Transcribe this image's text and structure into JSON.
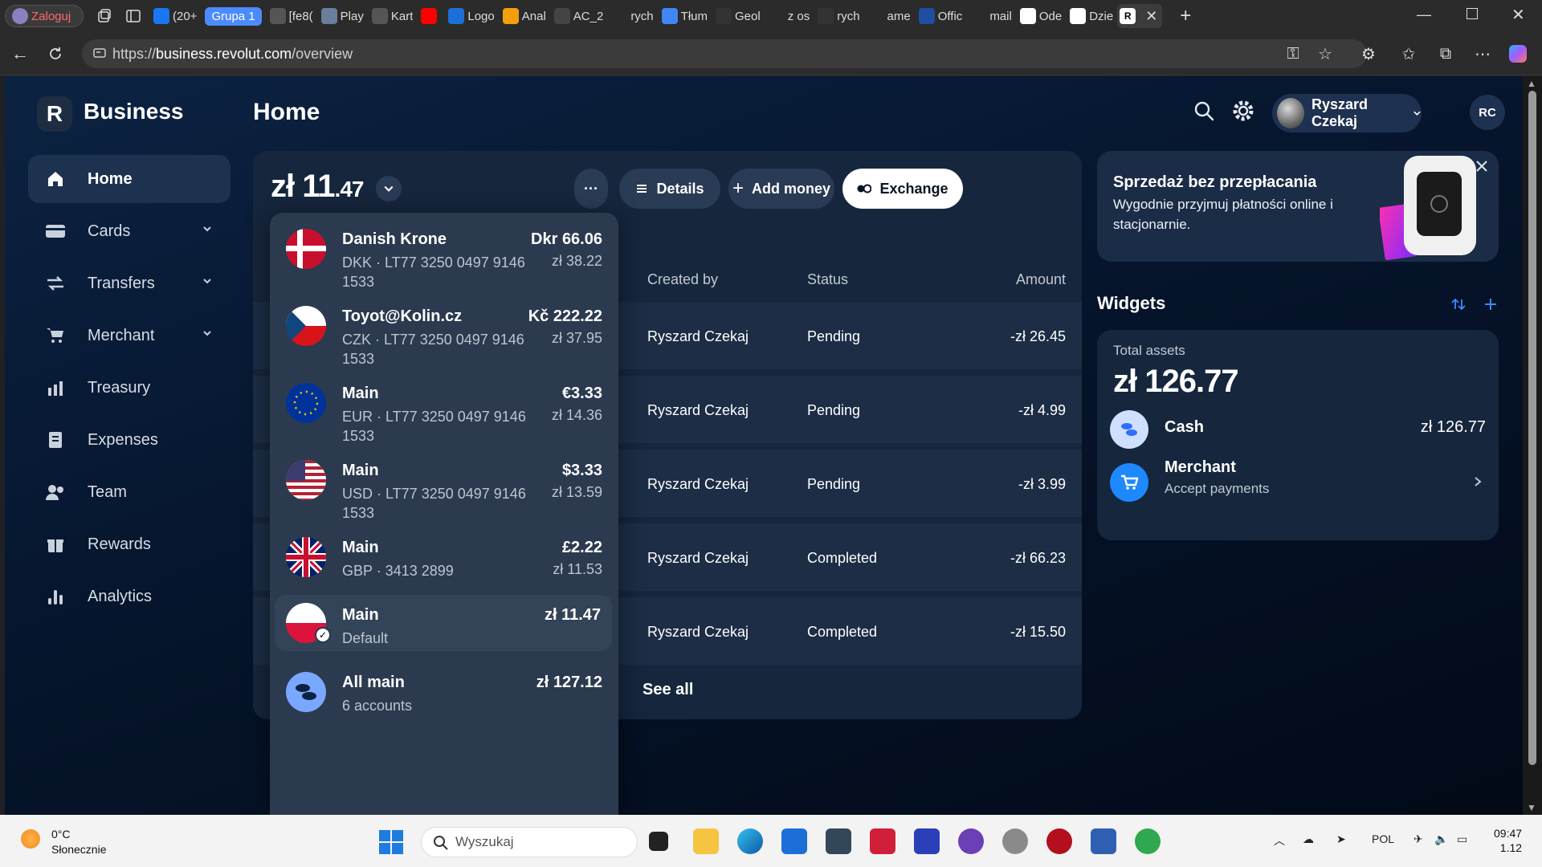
{
  "browser": {
    "profile_tab": "Zaloguj",
    "tabs": [
      {
        "label": "(20+",
        "icon": "facebook-icon"
      },
      {
        "label": "Grupa 1",
        "icon": "tab-group-pill"
      },
      {
        "label": "[fe8(",
        "icon": "globe-icon"
      },
      {
        "label": "Play",
        "icon": "image-icon"
      },
      {
        "label": "Kart",
        "icon": "globe-icon"
      },
      {
        "label": "",
        "icon": "youtube-icon"
      },
      {
        "label": "Logo",
        "icon": "edge-icon"
      },
      {
        "label": "Anal",
        "icon": "analytics-icon"
      },
      {
        "label": "AC_2",
        "icon": "flash-icon"
      },
      {
        "label": "rych",
        "icon": "search-icon"
      },
      {
        "label": "Tłum",
        "icon": "translate-icon"
      },
      {
        "label": "Geol",
        "icon": "github-icon"
      },
      {
        "label": "z os",
        "icon": "search-icon"
      },
      {
        "label": "rych",
        "icon": "github-icon"
      },
      {
        "label": "ame",
        "icon": "search-icon"
      },
      {
        "label": "Offic",
        "icon": "office-icon"
      },
      {
        "label": "mail",
        "icon": "search-icon"
      },
      {
        "label": "Ode",
        "icon": "gmail-icon"
      },
      {
        "label": "Dzie",
        "icon": "gmail-icon"
      }
    ],
    "active_tab_icon": "revolut-icon",
    "url_prefix": "https://",
    "url_host": "business.revolut.com",
    "url_path": "/overview"
  },
  "app": {
    "brand": "Business",
    "logo_letter": "R",
    "page_title": "Home",
    "sidebar": [
      {
        "label": "Home",
        "icon": "home-icon",
        "active": true,
        "expandable": false
      },
      {
        "label": "Cards",
        "icon": "card-icon",
        "active": false,
        "expandable": true
      },
      {
        "label": "Transfers",
        "icon": "transfer-icon",
        "active": false,
        "expandable": true
      },
      {
        "label": "Merchant",
        "icon": "cart-icon",
        "active": false,
        "expandable": true
      },
      {
        "label": "Treasury",
        "icon": "chart-icon",
        "active": false,
        "expandable": false
      },
      {
        "label": "Expenses",
        "icon": "receipt-icon",
        "active": false,
        "expandable": false
      },
      {
        "label": "Team",
        "icon": "team-icon",
        "active": false,
        "expandable": false
      },
      {
        "label": "Rewards",
        "icon": "gift-icon",
        "active": false,
        "expandable": false
      },
      {
        "label": "Analytics",
        "icon": "analytics-icon",
        "active": false,
        "expandable": false
      }
    ],
    "header": {
      "user_name": "Ryszard Czekaj",
      "initials": "RC"
    },
    "balance": {
      "currency": "zł",
      "integer": "11",
      "decimal": ".47"
    },
    "actions": {
      "more": "···",
      "details": "Details",
      "add_money": "Add money",
      "exchange": "Exchange"
    },
    "table": {
      "headers": {
        "created_by": "Created by",
        "status": "Status",
        "amount": "Amount"
      },
      "rows": [
        {
          "created_by": "Ryszard Czekaj",
          "status": "Pending",
          "amount": "-zł 26.45"
        },
        {
          "created_by": "Ryszard Czekaj",
          "status": "Pending",
          "amount": "-zł 4.99"
        },
        {
          "created_by": "Ryszard Czekaj",
          "status": "Pending",
          "amount": "-zł 3.99"
        },
        {
          "created_by": "Ryszard Czekaj",
          "status": "Completed",
          "amount": "-zł 66.23"
        },
        {
          "created_by": "Ryszard Czekaj",
          "status": "Completed",
          "amount": "-zł 15.50"
        }
      ],
      "see_all": "See all"
    },
    "accounts": [
      {
        "name": "Danish Krone",
        "sub": "DKK · LT77 3250 0497 9146 1533",
        "amount": "Dkr 66.06",
        "pln": "zł 38.22",
        "flag": "dk"
      },
      {
        "name": "Toyot@Kolin.cz",
        "sub": "CZK · LT77 3250 0497 9146 1533",
        "amount": "Kč 222.22",
        "pln": "zł 37.95",
        "flag": "cz"
      },
      {
        "name": "Main",
        "sub": "EUR · LT77 3250 0497 9146 1533",
        "amount": "€3.33",
        "pln": "zł 14.36",
        "flag": "eu"
      },
      {
        "name": "Main",
        "sub": "USD · LT77 3250 0497 9146 1533",
        "amount": "$3.33",
        "pln": "zł 13.59",
        "flag": "us"
      },
      {
        "name": "Main",
        "sub": "GBP · 3413 2899",
        "amount": "£2.22",
        "pln": "zł 11.53",
        "flag": "gb"
      },
      {
        "name": "Main",
        "sub": "Default",
        "amount": "zł 11.47",
        "pln": "",
        "flag": "pl",
        "selected": true
      },
      {
        "name": "All main",
        "sub": "6 accounts",
        "amount": "zł 127.12",
        "pln": "",
        "flag": "all"
      }
    ],
    "promo": {
      "title": "Sprzedaż bez przepłacania",
      "body": "Wygodnie przyjmuj płatności online i stacjonarnie."
    },
    "widgets": {
      "title": "Widgets",
      "total_label": "Total assets",
      "total_value": "zł 126.77",
      "cash_label": "Cash",
      "cash_value": "zł 126.77",
      "merchant_label": "Merchant",
      "merchant_sub": "Accept payments"
    }
  },
  "taskbar": {
    "temp": "0°C",
    "weather": "Słonecznie",
    "search_placeholder": "Wyszukaj",
    "lang": "POL",
    "time": "09:47",
    "date": "1.12"
  },
  "colors": {
    "bg_dark": "#06152d",
    "card": "#16263d",
    "accent_blue": "#2f80ff",
    "widget_icon_blue": "#1e88ff"
  }
}
